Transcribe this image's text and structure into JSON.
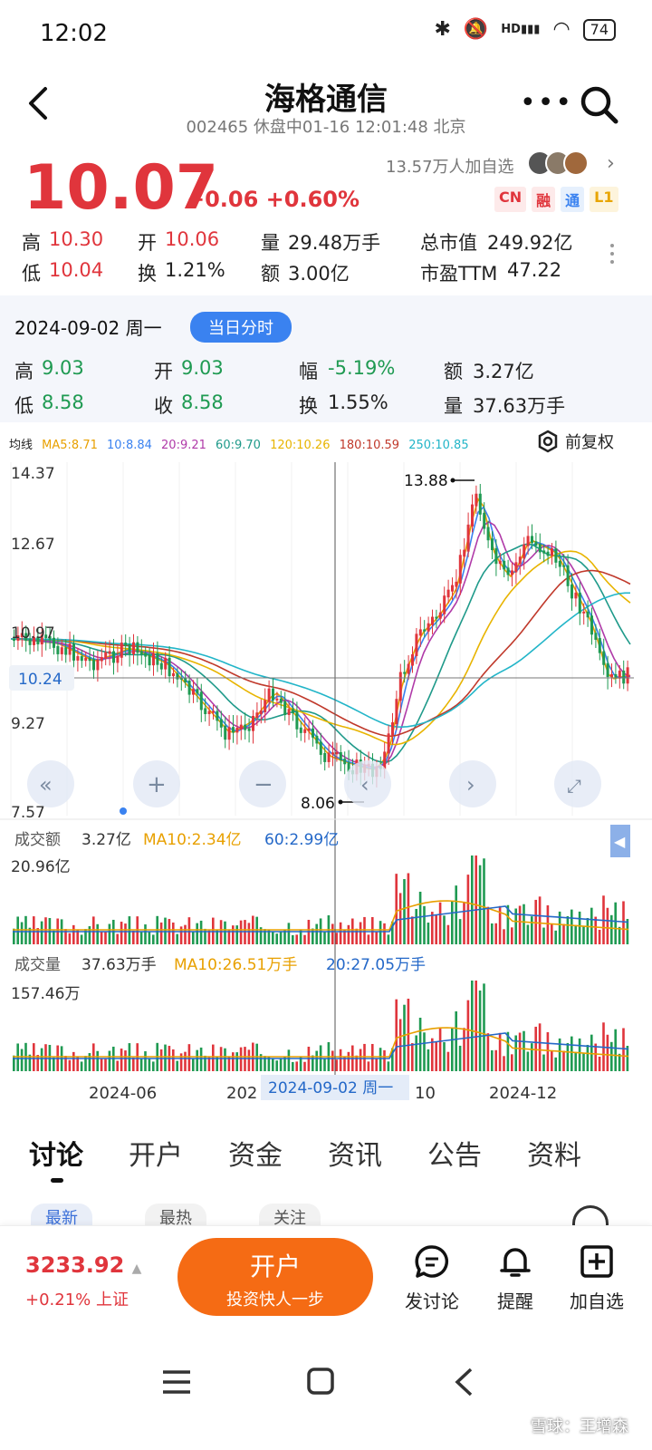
{
  "status_bar": {
    "time": "12:02",
    "hd": "HD",
    "battery": "74"
  },
  "header": {
    "title": "海格通信",
    "subtitle": "002465 休盘中01-16 12:01:48 北京"
  },
  "quote": {
    "price": "10.07",
    "change": "+0.06 +0.60%",
    "followers": "13.57万人加自选",
    "badges": [
      {
        "label": "CN",
        "color": "#e0353c"
      },
      {
        "label": "融",
        "color": "#e0353c"
      },
      {
        "label": "通",
        "color": "#3a82f0"
      },
      {
        "label": "L1",
        "color": "#e8a500"
      }
    ],
    "stats": {
      "high_label": "高",
      "high": "10.30",
      "open_label": "开",
      "open": "10.06",
      "vol_label": "量",
      "vol": "29.48万手",
      "mcap_label": "总市值",
      "mcap": "249.92亿",
      "low_label": "低",
      "low": "10.04",
      "turn_label": "换",
      "turn": "1.21%",
      "amt_label": "额",
      "amt": "3.00亿",
      "pe_label": "市盈TTM",
      "pe": "47.22"
    }
  },
  "history": {
    "date": "2024-09-02 周一",
    "tag": "当日分时",
    "high_label": "高",
    "high": "9.03",
    "open_label": "开",
    "open": "9.03",
    "range_label": "幅",
    "range": "-5.19%",
    "amt_label": "额",
    "amt": "3.27亿",
    "low_label": "低",
    "low": "8.58",
    "close_label": "收",
    "close": "8.58",
    "turn_label": "换",
    "turn": "1.55%",
    "vol_label": "量",
    "vol": "37.63万手"
  },
  "ma": {
    "label": "均线",
    "items": [
      {
        "text": "MA5:8.71",
        "color": "#e8a000"
      },
      {
        "text": "10:8.84",
        "color": "#3a82f0"
      },
      {
        "text": "20:9.21",
        "color": "#b03aa8"
      },
      {
        "text": "60:9.70",
        "color": "#1f9a8a"
      },
      {
        "text": "120:10.26",
        "color": "#e8b400"
      },
      {
        "text": "180:10.59",
        "color": "#c0392b"
      },
      {
        "text": "250:10.85",
        "color": "#22b5c8"
      }
    ],
    "adjust_label": "前复权"
  },
  "chart": {
    "y_ticks": [
      "14.37",
      "12.67",
      "10.97",
      "9.27",
      "7.57"
    ],
    "crosshair_price": "10.24",
    "max_label": "13.88",
    "min_label": "8.06",
    "amount_header": {
      "label": "成交额",
      "value": "3.27亿",
      "ma10": "MA10:2.34亿",
      "ma60": "60:2.99亿"
    },
    "amount_max": "20.96亿",
    "volume_header": {
      "label": "成交量",
      "value": "37.63万手",
      "ma10": "MA10:26.51万手",
      "ma20": "20:27.05万手"
    },
    "volume_max": "157.46万",
    "x_labels": {
      "a": "2024-06",
      "b": "202",
      "c": "10",
      "d": "2024-12"
    },
    "crosshair_date": "2024-09-02 周一"
  },
  "tabs": [
    "讨论",
    "开户",
    "资金",
    "资讯",
    "公告",
    "资料"
  ],
  "sub_tabs": [
    "最新",
    "最热",
    "关注"
  ],
  "bottom": {
    "index_value": "3233.92",
    "index_change": "+0.21% 上证",
    "open_account": "开户",
    "open_account_sub": "投资快人一步",
    "post": "发讨论",
    "alert": "提醒",
    "add_watch": "加自选"
  },
  "watermark": "雪球：王增森"
}
